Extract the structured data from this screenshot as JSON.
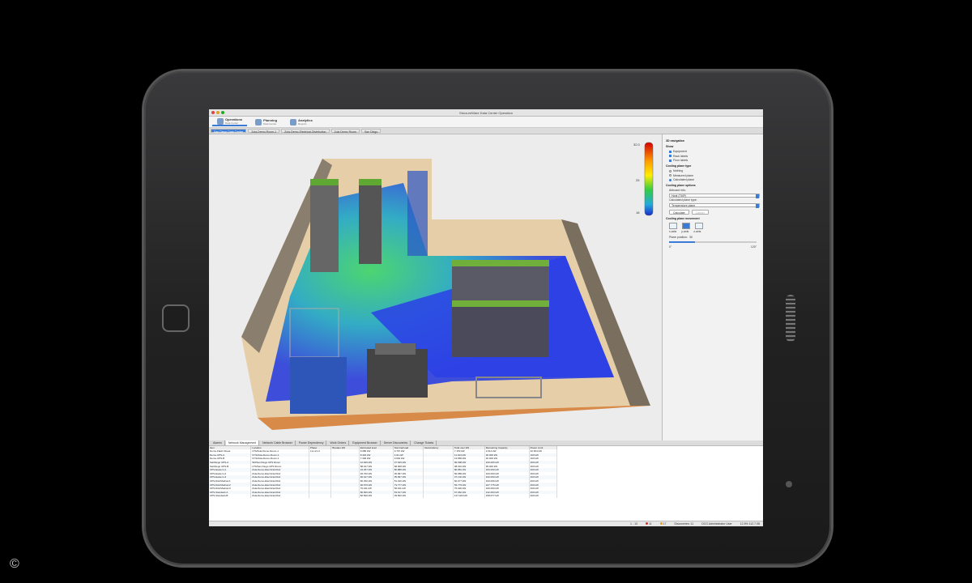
{
  "app": {
    "window_title": "StruxureWare Data Center Operation"
  },
  "modes": [
    {
      "label": "Operations",
      "sub": "Data Center",
      "active": true
    },
    {
      "label": "Planning",
      "sub": "Data Center",
      "active": false
    },
    {
      "label": "Analytics",
      "sub": "Reports",
      "active": false
    }
  ],
  "tabs": [
    {
      "label": "San Diego Data Center",
      "active": true
    },
    {
      "label": "Zola-Demo-Room-1",
      "active": false
    },
    {
      "label": "Zola-Demo-Electrical-Distribution",
      "active": false
    },
    {
      "label": "Zola Demo Room",
      "active": false
    },
    {
      "label": "San Diego",
      "active": false
    }
  ],
  "colorbar": {
    "max": "32.0",
    "mid": "25",
    "min": "18"
  },
  "side_panel": {
    "section_3d": "3D navigation",
    "section_show": "Show",
    "show_items": [
      "Equipment",
      "Rack labels",
      "Floor labels"
    ],
    "section_cooling": "Cooling plane type",
    "cooling_options": [
      {
        "label": "Nothing",
        "on": false
      },
      {
        "label": "Measured plane",
        "on": false
      },
      {
        "label": "Calculated plane",
        "on": true
      }
    ],
    "section_options": "Cooling plane options",
    "airboard_label": "Airboard info:",
    "airboard_value": "Heat (TMP)",
    "plane_type_label": "Calculated plane type:",
    "plane_type_value": "Temperature plane",
    "calc_button": "Calculate",
    "cancel_button": "Cancel",
    "section_movement": "Cooling plane movement",
    "planes": [
      "x-axis",
      "y-axis",
      "z-axis"
    ],
    "plane_position_label": "Plane position:",
    "plane_position_value": "30",
    "plane_position_fraction": 0.3,
    "scale_min": "0\"",
    "scale_max": "120\""
  },
  "bottom_tabs": [
    {
      "label": "Alarms",
      "active": false
    },
    {
      "label": "Network Management",
      "active": true
    },
    {
      "label": "Network Cable Browser",
      "active": false
    },
    {
      "label": "Power Dependency",
      "active": false
    },
    {
      "label": "Work Orders",
      "active": false
    },
    {
      "label": "Equipment Browser",
      "active": false
    },
    {
      "label": "Server Discoveries",
      "active": false
    },
    {
      "label": "Change Tickets",
      "active": false
    }
  ],
  "table": {
    "columns": [
      "Item",
      "Location",
      "Phase",
      "Breaker kW",
      "Estimated load",
      "Nominal load",
      "Redundancy",
      "Total user kW",
      "Remaining Capacity",
      "Power Limit"
    ],
    "rows": [
      [
        "Demo-Flash-Street",
        "LTS/Zola-Demo-Room-1",
        "L1-L2-L3",
        "",
        "6.686 kW",
        "9.767 kW",
        "",
        "7.153 kW",
        "2.614 kW",
        "22.604 kW"
      ],
      [
        "Demo-UPS-A",
        "SYS/Zola-Demo-Room-1",
        "",
        "",
        "8.422 kW",
        "4.91 kW",
        "",
        "11.913 kW",
        "30.000 kW",
        "100 kW"
      ],
      [
        "Demo-UPS-B",
        "SYS/Zola-Demo-Room-1",
        "",
        "",
        "7.306 kW",
        "9.602 kW",
        "",
        "13.869 kW",
        "40.000 kW",
        "100 kW"
      ],
      [
        "SanDiego UPS-A",
        "SD/San Diego UPS Room",
        "",
        "",
        "12.949 kW",
        "37.649 kW",
        "",
        "99.998 kW",
        "100.000 kW",
        "200 kW"
      ],
      [
        "SanDiego UPS-B",
        "LTS/San Diego UPS Room",
        "",
        "",
        "58.017 kW",
        "68.008 kW",
        "",
        "38.019 kW",
        "95.000 kW",
        "200 kW"
      ],
      [
        "UPS-Eastern-1",
        "Zola-Demo-Electrical-Distr",
        "",
        "",
        "34.457 kW",
        "80.888 kW",
        "",
        "80.881 kW",
        "100.000 kW",
        "400 kW"
      ],
      [
        "UPS-Eastern-2",
        "Zola-Demo-Electrical-Distr",
        "",
        "",
        "93.700 kW",
        "36.997 kW",
        "",
        "50.989 kW",
        "100.000 kW",
        "400 kW"
      ],
      [
        "UPS-Eastern-3",
        "Zola-Demo-Electrical-Distr",
        "",
        "",
        "60.017 kW",
        "35.997 kW",
        "",
        "37.102 kW",
        "100.000 kW",
        "400 kW"
      ],
      [
        "UPS-DistrMedium1",
        "Zola-Demo-Electrical-Distr",
        "",
        "",
        "60.332 kW",
        "51.016 kW",
        "",
        "60.077 kW",
        "100.000 kW",
        "400 kW"
      ],
      [
        "UPS-DistrMedium2",
        "Zola-Demo-Electrical-Distr",
        "",
        "",
        "90.679 kW",
        "73.777 kW",
        "",
        "53.779 kW",
        "227.775 kW",
        "400 kW"
      ],
      [
        "UPS-DistrMedium3",
        "Zola-Demo-Electrical-Distr",
        "",
        "",
        "70.011 kW",
        "50.011 kW",
        "",
        "75.026 kW",
        "100.000 kW",
        "400 kW"
      ],
      [
        "UPS-Standard-A",
        "Zola-Demo-Electrical-Distr",
        "",
        "",
        "80.606 kW",
        "53.617 kW",
        "",
        "67.062 kW",
        "132.063 kW",
        "400 kW"
      ],
      [
        "UPS-Standard-B",
        "Zola-Demo-Electrical-Distr",
        "",
        "",
        "82.500 kW",
        "39.500 kW",
        "",
        "137.023 kW",
        "158.077 kW",
        "400 kW"
      ]
    ]
  },
  "status": {
    "paging": "1 - 13",
    "alarms_critical": "11",
    "alarms_warning": "17",
    "discoveries": "Discoveries: 11",
    "user": "DCO Administrator User",
    "clock": "12.5% 112.7.08"
  },
  "copyright": "©",
  "colors": {
    "accent": "#3a7bd5",
    "floor": "#e6cfa8",
    "wall": "#847868"
  }
}
